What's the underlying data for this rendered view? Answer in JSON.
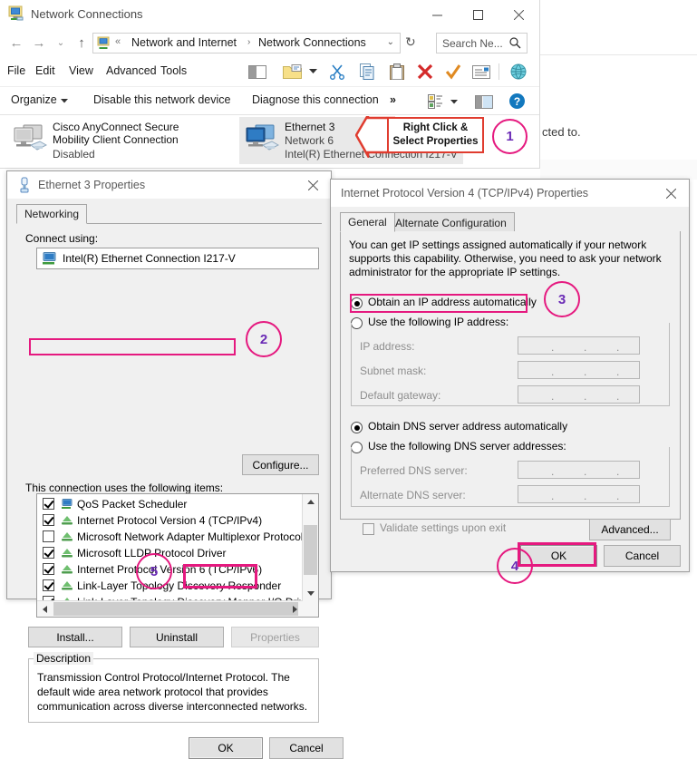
{
  "background": {
    "cut_text": "cted to."
  },
  "explorer": {
    "title": "Network Connections",
    "title_icon": "network-connections-icon",
    "window_buttons": {
      "minimize": "—",
      "maximize": "□",
      "close": "✕"
    },
    "nav": {
      "back": "←",
      "forward": "→",
      "history": "⌄",
      "up": "↑",
      "refresh": "↻"
    },
    "address": {
      "chevrons": "«",
      "segment1": "Network and Internet",
      "separator": "›",
      "segment2": "Network Connections",
      "dropdown": "⌄"
    },
    "search": {
      "placeholder": "Search Ne...",
      "icon": "search-icon"
    },
    "menu": [
      "File",
      "Edit",
      "View",
      "Advanced",
      "Tools"
    ],
    "commands": {
      "organize": "Organize",
      "disable": "Disable this network device",
      "diagnose": "Diagnose this connection",
      "overflow": "»"
    },
    "connections": [
      {
        "name": "Cisco AnyConnect Secure Mobility Client Connection",
        "network": "",
        "adapter": "Disabled",
        "selected": false
      },
      {
        "name": "Ethernet 3",
        "network": "Network  6",
        "adapter": "Intel(R) Ethernet Connection I217-V",
        "selected": true
      }
    ]
  },
  "annotations": {
    "callout": {
      "line1": "Right Click &",
      "line2": "Select Properties"
    },
    "steps": [
      "1",
      "2",
      "3",
      "4",
      "5"
    ],
    "accent_pink": "#e5197f",
    "accent_purple": "#6a2ab5",
    "accent_red": "#e03c2f"
  },
  "ethernet_dialog": {
    "title": "Ethernet 3 Properties",
    "title_icon": "network-adapter-icon",
    "close": "✕",
    "tabs": [
      {
        "label": "Networking",
        "active": true
      }
    ],
    "connect_using_label": "Connect using:",
    "adapter_value": "Intel(R) Ethernet Connection I217-V",
    "adapter_icon": "nic-icon",
    "configure_button": "Configure...",
    "items_label": "This connection uses the following items:",
    "items": [
      {
        "label": "QoS Packet Scheduler",
        "checked": true,
        "icon": "qos-icon"
      },
      {
        "label": "Internet Protocol Version 4 (TCP/IPv4)",
        "checked": true,
        "icon": "protocol-icon",
        "highlighted": true
      },
      {
        "label": "Microsoft Network Adapter Multiplexor Protocol",
        "checked": false,
        "icon": "protocol-icon"
      },
      {
        "label": "Microsoft LLDP Protocol Driver",
        "checked": true,
        "icon": "protocol-icon"
      },
      {
        "label": "Internet Protocol Version 6 (TCP/IPv6)",
        "checked": true,
        "icon": "protocol-icon"
      },
      {
        "label": "Link-Layer Topology Discovery Responder",
        "checked": true,
        "icon": "protocol-icon"
      },
      {
        "label": "Link-Layer Topology Discovery Mapper I/O Driver",
        "checked": true,
        "icon": "protocol-icon"
      }
    ],
    "buttons": {
      "install": "Install...",
      "uninstall": "Uninstall",
      "properties": "Properties",
      "properties_disabled": true
    },
    "description_caption": "Description",
    "description_text": "Transmission Control Protocol/Internet Protocol. The default wide area network protocol that provides communication across diverse interconnected networks.",
    "ok": "OK",
    "cancel": "Cancel"
  },
  "ipv4_dialog": {
    "title": "Internet Protocol Version 4 (TCP/IPv4) Properties",
    "close": "✕",
    "tabs": [
      {
        "label": "General",
        "active": true
      },
      {
        "label": "Alternate Configuration",
        "active": false
      }
    ],
    "intro": "You can get IP settings assigned automatically if your network supports this capability. Otherwise, you need to ask your network administrator for the appropriate IP settings.",
    "ip_auto_label": "Obtain an IP address automatically",
    "ip_auto_selected": true,
    "ip_manual_label": "Use the following IP address:",
    "ip_manual_selected": false,
    "ip_fields": [
      {
        "label": "IP address:",
        "value": ""
      },
      {
        "label": "Subnet mask:",
        "value": ""
      },
      {
        "label": "Default gateway:",
        "value": ""
      }
    ],
    "dns_auto_label": "Obtain DNS server address automatically",
    "dns_auto_selected": true,
    "dns_manual_label": "Use the following DNS server addresses:",
    "dns_manual_selected": false,
    "dns_fields": [
      {
        "label": "Preferred DNS server:",
        "value": ""
      },
      {
        "label": "Alternate DNS server:",
        "value": ""
      }
    ],
    "validate_label": "Validate settings upon exit",
    "validate_checked": false,
    "advanced_button": "Advanced...",
    "ok": "OK",
    "cancel": "Cancel"
  }
}
